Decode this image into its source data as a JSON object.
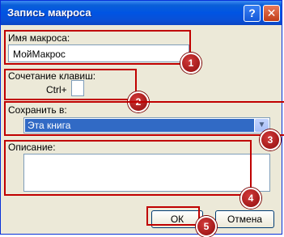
{
  "window": {
    "title": "Запись макроса"
  },
  "titlebar_buttons": {
    "help": "?",
    "close": "✕"
  },
  "macro_name": {
    "label": "Имя макроса:",
    "value": "МойМакрос"
  },
  "shortcut": {
    "label": "Сочетание клавиш:",
    "prefix": "Ctrl+",
    "value": ""
  },
  "store_in": {
    "label": "Сохранить в:",
    "selected": "Эта книга"
  },
  "description": {
    "label": "Описание:",
    "value": ""
  },
  "buttons": {
    "ok": "ОК",
    "cancel": "Отмена"
  },
  "markers": [
    "1",
    "2",
    "3",
    "4",
    "5"
  ],
  "colors": {
    "marker": "#c00000",
    "selection": "#316ac5",
    "titlebar": "#0054e3"
  }
}
